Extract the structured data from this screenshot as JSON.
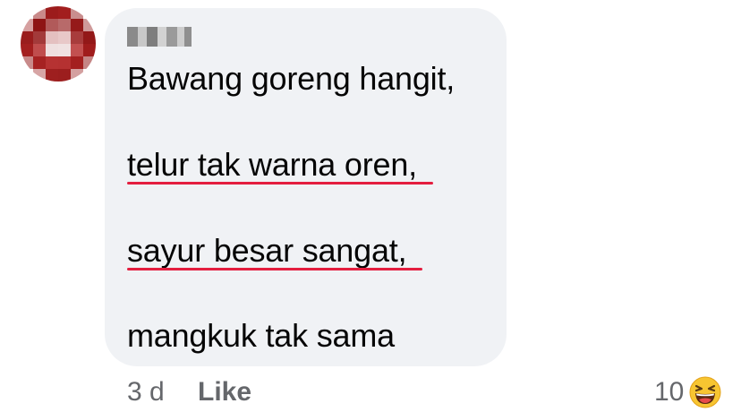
{
  "comment": {
    "lines": [
      "Bawang goreng hangit,",
      "telur tak warna oren,",
      "sayur besar sangat,",
      "mangkuk tak sama"
    ]
  },
  "actions": {
    "timestamp": "3 d",
    "like_label": "Like"
  },
  "reactions": {
    "count": "10",
    "icon": "laughing-emoji-icon"
  },
  "colors": {
    "bubble": "#f0f2f5",
    "text": "#050505",
    "meta": "#65676b",
    "underline": "#e41e3f"
  }
}
